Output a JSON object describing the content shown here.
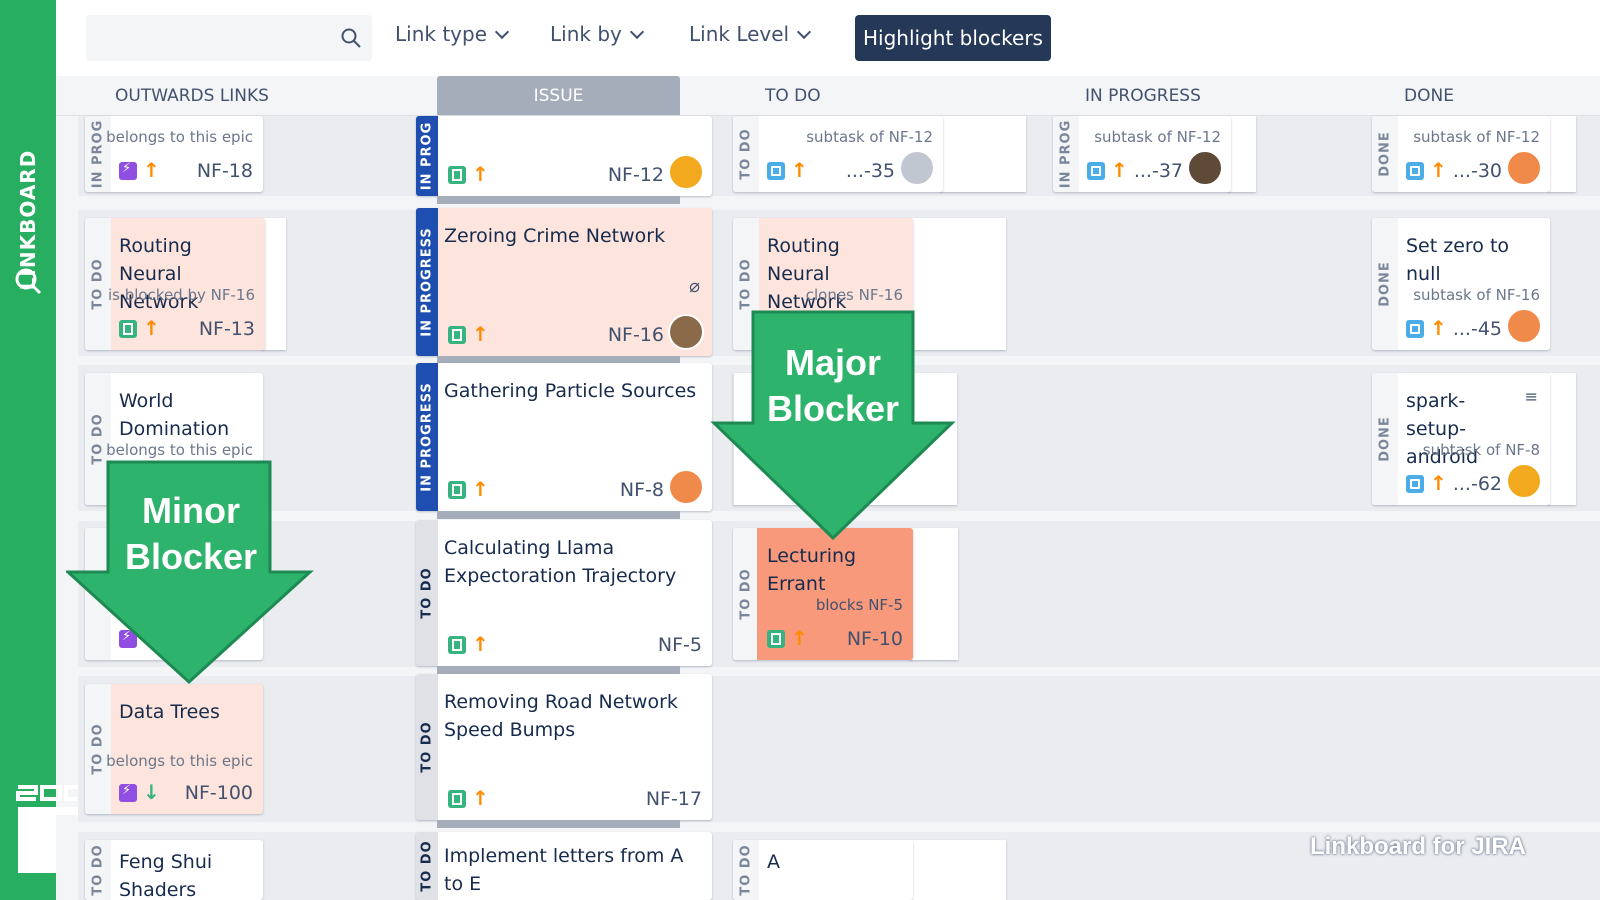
{
  "app": {
    "name": "LINKBOARD",
    "watermark": "Linkboard for JIRA"
  },
  "toolbar": {
    "search_placeholder": "",
    "link_type": "Link type",
    "link_by": "Link by",
    "link_level": "Link Level",
    "highlight_blockers": "Highlight blockers"
  },
  "columns": {
    "outwards": "OUTWARDS LINKS",
    "issue": "ISSUE",
    "todo": "TO DO",
    "in_progress": "IN PROGRESS",
    "done": "DONE"
  },
  "status": {
    "in_prog": "IN PROG",
    "in_progress": "IN PROGRESS",
    "todo": "TO DO",
    "done": "DONE"
  },
  "rows": [
    {
      "out": {
        "title": "",
        "rel": "belongs to this epic",
        "key": "NF-18"
      },
      "issue": {
        "key": "NF-12"
      },
      "todo": {
        "rel": "subtask of NF-12",
        "key": "...-35"
      },
      "inprog": {
        "rel": "subtask of NF-12",
        "key": "...-37"
      },
      "done": {
        "rel": "subtask of NF-12",
        "key": "...-30"
      }
    },
    {
      "out": {
        "title": "Routing Neural Network",
        "rel": "is blocked by NF-16",
        "key": "NF-13"
      },
      "issue": {
        "title": "Zeroing Crime Network",
        "key": "NF-16"
      },
      "todo": {
        "title": "Routing Neural Network",
        "rel": "clones NF-16"
      },
      "done": {
        "title": "Set zero to null",
        "rel": "subtask of NF-16",
        "key": "...-45"
      }
    },
    {
      "out": {
        "title": "World Domination",
        "rel": "belongs to this epic"
      },
      "issue": {
        "title": "Gathering Particle Sources",
        "key": "NF-8"
      },
      "done": {
        "title": "spark-setup-android",
        "rel": "subtask of NF-8",
        "key": "...-62"
      }
    },
    {
      "issue": {
        "title": "Calculating Llama Expectoration Trajectory",
        "key": "NF-5"
      },
      "todo": {
        "title": "Lecturing Errant",
        "rel": "blocks NF-5",
        "key": "NF-10"
      }
    },
    {
      "out": {
        "title": "Data Trees",
        "rel": "belongs to this epic",
        "key": "NF-100"
      },
      "issue": {
        "title": "Removing Road Network Speed Bumps",
        "key": "NF-17"
      }
    },
    {
      "out": {
        "title": "Feng Shui Shaders"
      },
      "issue": {
        "title": "Implement letters from A to E"
      },
      "todo": {
        "title": "A"
      }
    }
  ],
  "callouts": {
    "major": "Major Blocker",
    "minor": "Minor Blocker"
  },
  "colors": {
    "sidebar": "#27ae60",
    "button": "#253858",
    "callout": "#2db36b",
    "blocker": "#f7997a",
    "in_progress": "#1e4fb0"
  }
}
